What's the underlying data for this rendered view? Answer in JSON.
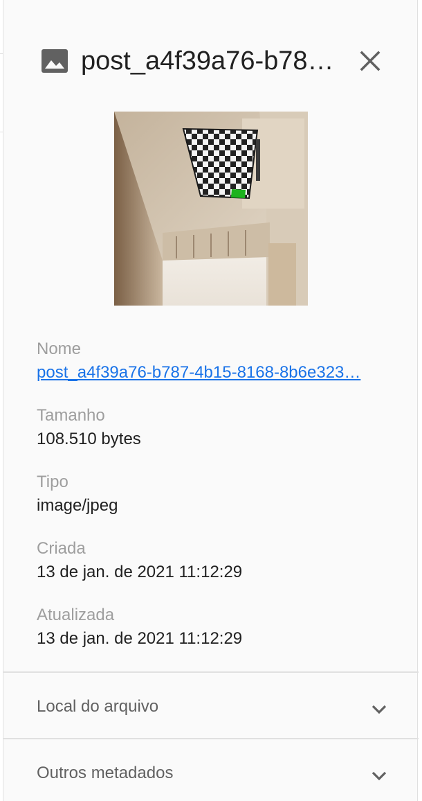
{
  "panel": {
    "title": "post_a4f39a76-b78…",
    "file_icon": "image-icon",
    "close_icon": "close-icon"
  },
  "details": {
    "name_label": "Nome",
    "name_value": "post_a4f39a76-b787-4b15-8168-8b6e323…",
    "size_label": "Tamanho",
    "size_value": "108.510 bytes",
    "type_label": "Tipo",
    "type_value": "image/jpeg",
    "created_label": "Criada",
    "created_value": "13 de jan. de 2021 11:12:29",
    "updated_label": "Atualizada",
    "updated_value": "13 de jan. de 2021 11:12:29"
  },
  "sections": {
    "location_label": "Local do arquivo",
    "metadata_label": "Outros metadados",
    "chevron_icon": "chevron-down-icon"
  },
  "colors": {
    "link": "#1a73e8",
    "label": "#9e9e9e",
    "text": "#212121",
    "icon": "#616161",
    "panel_bg": "#fafafa"
  }
}
